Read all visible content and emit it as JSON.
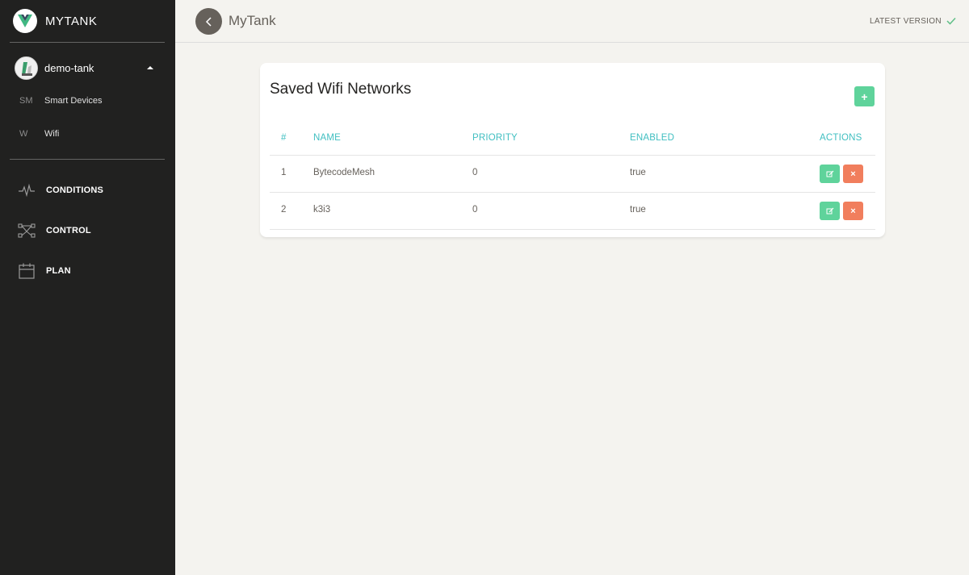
{
  "brand": {
    "name": "MYTANK",
    "logo_icon": "vue-logo-icon"
  },
  "user": {
    "name": "demo-tank"
  },
  "sidebar": {
    "sub_items": [
      {
        "abbr": "SM",
        "label": "Smart Devices"
      },
      {
        "abbr": "W",
        "label": "Wifi"
      }
    ],
    "nav_items": [
      {
        "label": "CONDITIONS",
        "icon": "pulse-icon"
      },
      {
        "label": "CONTROL",
        "icon": "network-icon"
      },
      {
        "label": "PLAN",
        "icon": "calendar-icon"
      }
    ]
  },
  "topbar": {
    "title": "MyTank",
    "version_label": "LATEST VERSION"
  },
  "card": {
    "title": "Saved Wifi Networks",
    "add_label": "+",
    "columns": {
      "index": "#",
      "name": "NAME",
      "priority": "PRIORITY",
      "enabled": "ENABLED",
      "actions": "ACTIONS"
    },
    "rows": [
      {
        "index": "1",
        "name": "BytecodeMesh",
        "priority": "0",
        "enabled": "true"
      },
      {
        "index": "2",
        "name": "k3i3",
        "priority": "0",
        "enabled": "true"
      }
    ],
    "delete_label": "×"
  },
  "colors": {
    "sidebar_bg": "#212120",
    "accent_teal": "#40bfc1",
    "success_green": "#5fd39b",
    "danger_orange": "#f17e5d",
    "page_bg": "#f4f3ef"
  }
}
